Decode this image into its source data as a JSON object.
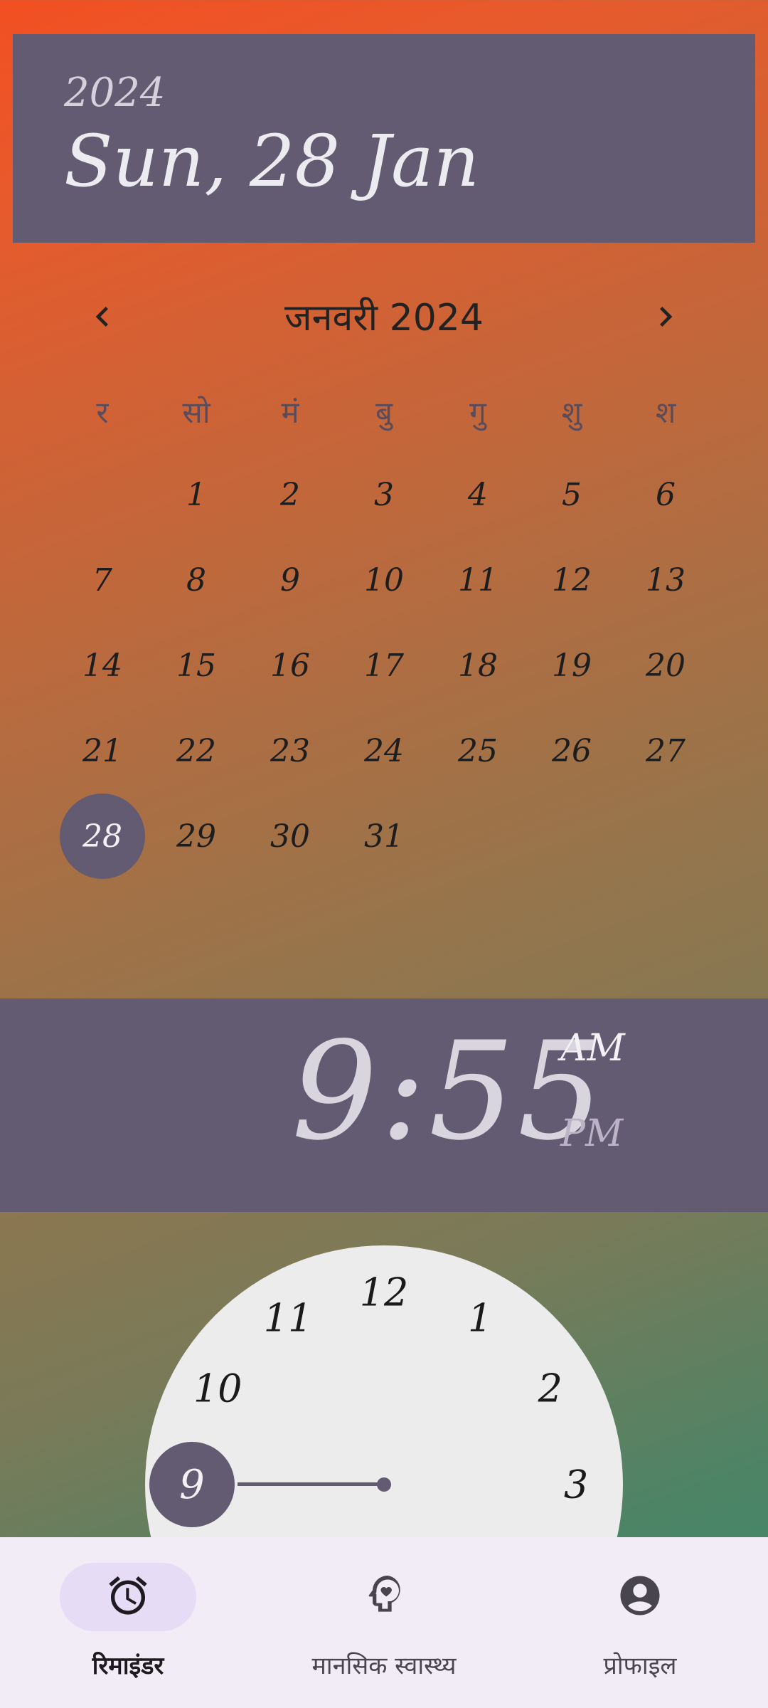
{
  "header": {
    "year": "2024",
    "date": "Sun, 28 Jan"
  },
  "calendar": {
    "title": "जनवरी 2024",
    "prev_icon": "chevron-left-icon",
    "next_icon": "chevron-right-icon",
    "weekdays": [
      "र",
      "सो",
      "मं",
      "बु",
      "गु",
      "शु",
      "श"
    ],
    "leading_blanks": 1,
    "days": [
      "1",
      "2",
      "3",
      "4",
      "5",
      "6",
      "7",
      "8",
      "9",
      "10",
      "11",
      "12",
      "13",
      "14",
      "15",
      "16",
      "17",
      "18",
      "19",
      "20",
      "21",
      "22",
      "23",
      "24",
      "25",
      "26",
      "27",
      "28",
      "29",
      "30",
      "31"
    ],
    "selected_day": "28"
  },
  "time": {
    "display": "9:55",
    "am": "AM",
    "pm": "PM",
    "selected_period": "AM"
  },
  "dial": {
    "numbers": [
      "12",
      "1",
      "2",
      "3",
      "10",
      "11"
    ],
    "selected_hour": "9"
  },
  "nav": {
    "items": [
      {
        "label": "रिमाइंडर",
        "icon": "alarm-clock-icon",
        "active": true
      },
      {
        "label": "मानसिक स्वास्थ्य",
        "icon": "mental-health-icon",
        "active": false
      },
      {
        "label": "प्रोफाइल",
        "icon": "account-circle-icon",
        "active": false
      }
    ]
  },
  "colors": {
    "primary": "#635b72",
    "surface": "#f2ecf6",
    "pill": "#e6dcf6"
  }
}
